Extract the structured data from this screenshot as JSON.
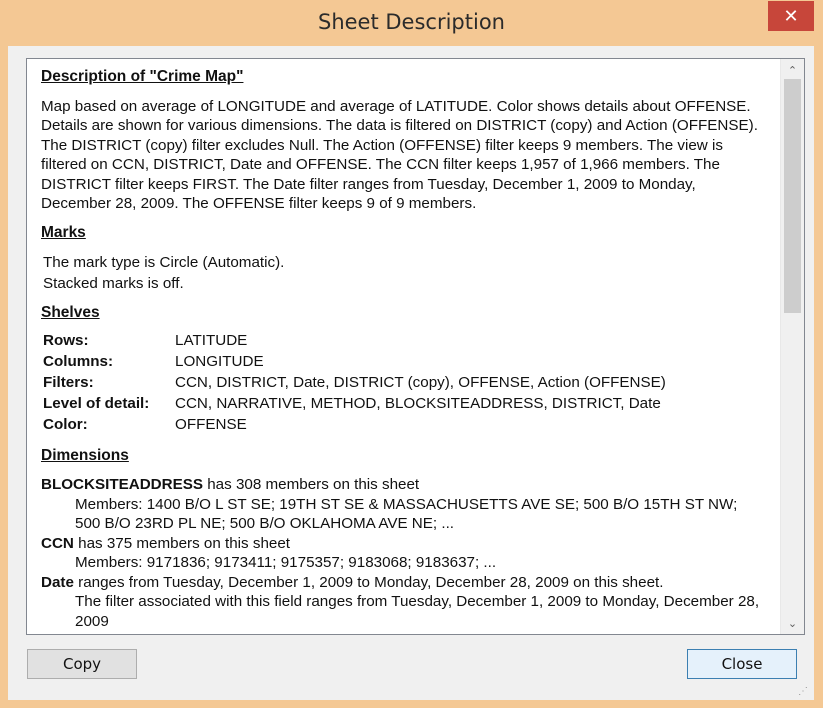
{
  "window": {
    "title": "Sheet Description",
    "close_glyph": "✕"
  },
  "description": {
    "heading": "Description of \"Crime Map\"",
    "body": "Map based on average of LONGITUDE and average of LATITUDE.  Color shows details about OFFENSE.  Details are shown for various dimensions. The data is filtered on DISTRICT (copy) and Action (OFFENSE). The DISTRICT (copy) filter excludes Null. The Action (OFFENSE) filter keeps 9 members. The view is filtered on CCN, DISTRICT, Date and OFFENSE. The CCN filter keeps 1,957 of 1,966 members. The DISTRICT filter keeps FIRST. The Date filter ranges from Tuesday, December 1, 2009 to Monday, December 28, 2009. The OFFENSE filter keeps 9 of 9 members."
  },
  "marks": {
    "heading": "Marks",
    "line1": "The mark type is Circle (Automatic).",
    "line2": "Stacked marks is off."
  },
  "shelves": {
    "heading": "Shelves",
    "rows": [
      {
        "key": "Rows:",
        "value": "LATITUDE"
      },
      {
        "key": "Columns:",
        "value": "LONGITUDE"
      },
      {
        "key": "Filters:",
        "value": "CCN, DISTRICT, Date, DISTRICT (copy), OFFENSE, Action (OFFENSE)"
      },
      {
        "key": "Level of detail:",
        "value": "CCN, NARRATIVE, METHOD, BLOCKSITEADDRESS, DISTRICT, Date"
      },
      {
        "key": "Color:",
        "value": "OFFENSE"
      }
    ]
  },
  "dimensions": {
    "heading": "Dimensions",
    "items": [
      {
        "name": "BLOCKSITEADDRESS",
        "summary": " has 308 members on this sheet",
        "detail": "Members: 1400 B/O L ST SE; 19TH ST SE & MASSACHUSETTS AVE SE; 500 B/O 15TH ST NW; 500 B/O 23RD PL NE; 500 B/O OKLAHOMA AVE NE; ..."
      },
      {
        "name": "CCN",
        "summary": " has 375 members on this sheet",
        "detail": "Members: 9171836; 9173411; 9175357; 9183068; 9183637; ..."
      },
      {
        "name": "Date",
        "summary": " ranges from Tuesday, December 1, 2009 to Monday, December 28, 2009 on this sheet.",
        "detail": "The filter associated with this field ranges from Tuesday, December 1, 2009 to Monday, December 28, 2009"
      }
    ]
  },
  "buttons": {
    "copy": "Copy",
    "close": "Close"
  },
  "scrollbar": {
    "up_glyph": "⌃",
    "down_glyph": "⌄"
  },
  "colors": {
    "title_bar": "#f4c894",
    "close_button": "#c7463a",
    "close_button_border": "#3c7fb1"
  }
}
